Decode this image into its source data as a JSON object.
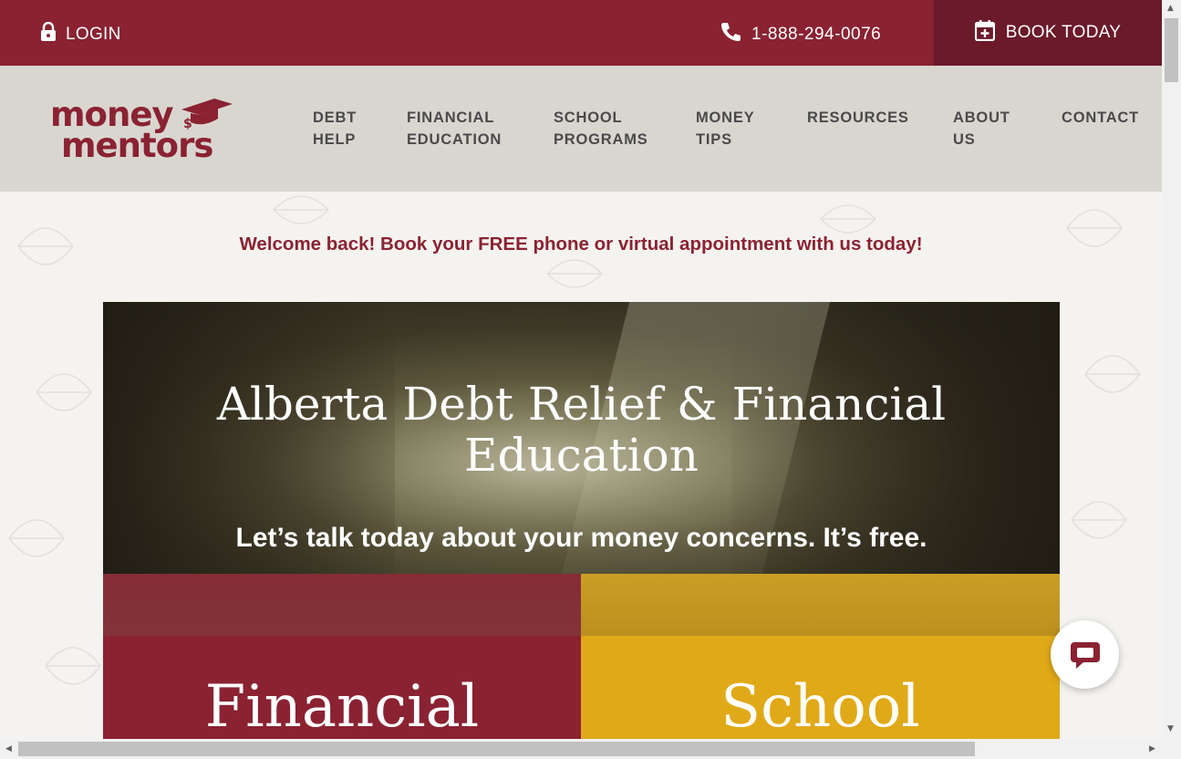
{
  "topbar": {
    "login_label": "LOGIN",
    "phone_label": "1-888-294-0076",
    "book_label": "BOOK TODAY"
  },
  "logo": {
    "line1": "money",
    "line2": "mentors"
  },
  "nav": {
    "items": [
      {
        "label": "DEBT\nHELP"
      },
      {
        "label": "FINANCIAL\nEDUCATION"
      },
      {
        "label": "SCHOOL\nPROGRAMS"
      },
      {
        "label": "MONEY\nTIPS"
      },
      {
        "label": "RESOURCES"
      },
      {
        "label": "ABOUT\nUS"
      },
      {
        "label": "CONTACT"
      }
    ]
  },
  "welcome": "Welcome back! Book your FREE phone or virtual appointment with us today!",
  "hero": {
    "title": "Alberta Debt Relief & Financial Education",
    "subtitle": "Let’s talk today about your money concerns. It’s free."
  },
  "tiles": [
    {
      "title": "Financial"
    },
    {
      "title": "School"
    }
  ],
  "colors": {
    "brand_red": "#8a2232",
    "dark_red": "#6b1a2a",
    "nav_bg": "#d9d6d0",
    "accent_yellow": "#e0a918"
  },
  "icons": [
    "lock-icon",
    "phone-icon",
    "calendar-plus-icon",
    "graduation-cap-icon",
    "chat-icon"
  ]
}
